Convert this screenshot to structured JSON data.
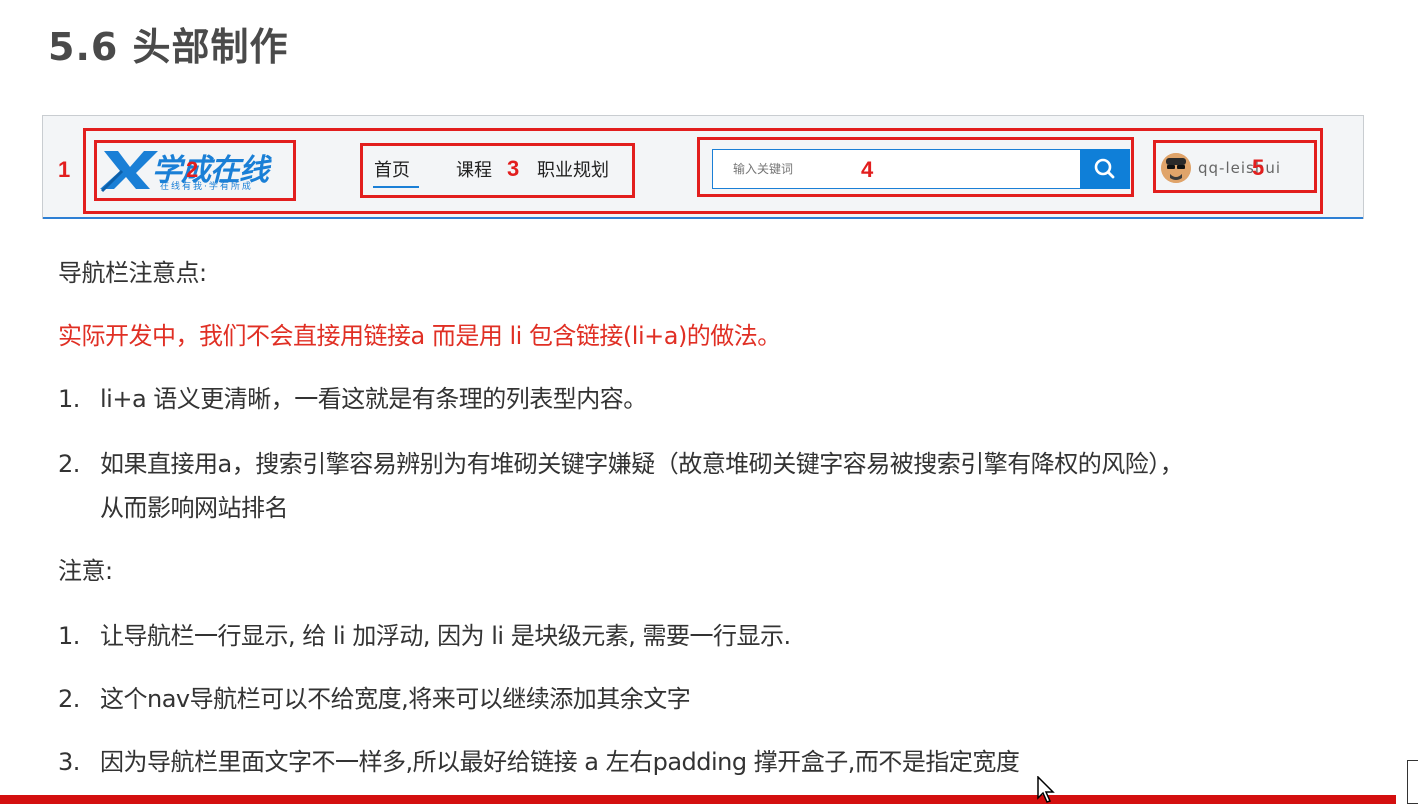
{
  "title": "5.6 头部制作",
  "header": {
    "logo": {
      "text": "学成在线",
      "subtitle": "在线有我·学有所成"
    },
    "nav": [
      "首页",
      "课程",
      "职业规划"
    ],
    "search": {
      "placeholder": "输入关键词"
    },
    "user": {
      "name": "qq-leishui"
    },
    "markers": [
      "1",
      "2",
      "3",
      "4",
      "5"
    ]
  },
  "content": {
    "nav_notes_title": "导航栏注意点:",
    "highlight": "实际开发中，我们不会直接用链接a 而是用 li  包含链接(li+a)的做法。",
    "points": [
      {
        "num": "1.",
        "text": "li+a 语义更清晰，一看这就是有条理的列表型内容。"
      },
      {
        "num": "2.",
        "text": "如果直接用a，搜索引擎容易辨别为有堆砌关键字嫌疑（故意堆砌关键字容易被搜索引擎有降权的风险），",
        "cont": "从而影响网站排名"
      }
    ],
    "notice_title": "注意:",
    "notes": [
      {
        "num": "1.",
        "text": "让导航栏一行显示, 给 li 加浮动, 因为 li 是块级元素, 需要一行显示."
      },
      {
        "num": "2.",
        "text": "这个nav导航栏可以不给宽度,将来可以继续添加其余文字"
      },
      {
        "num": "3.",
        "text": "因为导航栏里面文字不一样多,所以最好给链接 a 左右padding 撑开盒子,而不是指定宽度"
      }
    ]
  },
  "colors": {
    "accent_red": "#e21e1e",
    "brand_blue": "#1a7fd6",
    "highlight_text": "#e02f24"
  },
  "icons": [
    "logo-x-icon",
    "search-icon",
    "avatar",
    "mouse-cursor-icon"
  ]
}
